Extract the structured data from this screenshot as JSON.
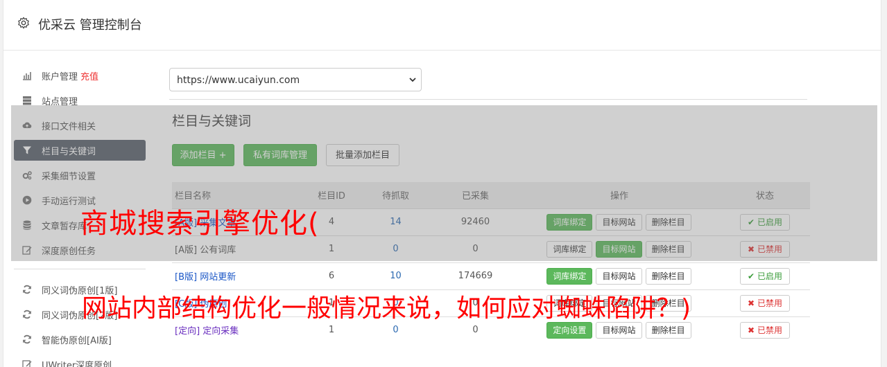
{
  "header": {
    "title": "优采云 管理控制台"
  },
  "sidebar": {
    "items": [
      {
        "label": "账户管理",
        "extra": "充值",
        "icon": "bar-chart-icon"
      },
      {
        "label": "站点管理",
        "icon": "server-icon"
      },
      {
        "label": "接口文件相关",
        "icon": "cloud-upload-icon"
      },
      {
        "label": "栏目与关键词",
        "icon": "filter-icon",
        "active": true
      },
      {
        "label": "采集细节设置",
        "icon": "gears-icon"
      },
      {
        "label": "手动运行测试",
        "icon": "play-circle-icon"
      },
      {
        "label": "文章暂存库",
        "icon": "database-icon"
      },
      {
        "label": "深度原创任务",
        "icon": "edit-icon"
      }
    ],
    "items2": [
      {
        "label": "同义词伪原创[1版]",
        "icon": "refresh-icon"
      },
      {
        "label": "同义词伪原创[2版]",
        "icon": "refresh-icon"
      },
      {
        "label": "智能伪原创[AI版]",
        "icon": "refresh-icon"
      },
      {
        "label": "UWriter深度原创",
        "icon": "edit-icon"
      }
    ]
  },
  "main": {
    "site_select": "https://www.ucaiyun.com",
    "section_title": "栏目与关键词",
    "buttons": {
      "add": "添加栏目 +",
      "private_lib": "私有词库管理",
      "batch_add": "批量添加栏目"
    },
    "table": {
      "headers": [
        "栏目名称",
        "栏目ID",
        "待抓取",
        "已采集",
        "操作",
        "状态"
      ],
      "rows": [
        {
          "tag": "[A版]",
          "name": "采集文章",
          "id": "4",
          "pending": "14",
          "collected": "92460",
          "ops": [
            "词库绑定",
            "目标网站",
            "删除栏目"
          ],
          "status": "已启用"
        },
        {
          "tag": "[A版]",
          "name": "公有词库",
          "id": "1",
          "pending": "0",
          "collected": "0",
          "ops": [
            "词库绑定",
            "目标网站",
            "删除栏目"
          ],
          "status": "已禁用"
        },
        {
          "tag": "[B版]",
          "name": "网站更新",
          "id": "6",
          "pending": "10",
          "collected": "174669",
          "ops": [
            "词库绑定",
            "目标网站",
            "删除栏目"
          ],
          "status": "已启用"
        },
        {
          "tag": "[C版]",
          "name": "伪原创",
          "id": "1",
          "pending": "0",
          "collected": "0",
          "ops": [
            "词库绑定",
            "目标网站",
            "删除栏目"
          ],
          "status": "已禁用"
        },
        {
          "tag": "[定向]",
          "name": "定向采集",
          "id": "1",
          "pending": "0",
          "collected": "0",
          "ops": [
            "定向设置",
            "目标网站",
            "删除栏目"
          ],
          "status": "已禁用"
        }
      ]
    }
  },
  "watermark": {
    "line1": "商城搜索引擎优化(",
    "line2": "网站内部结构优化一般情况来说，如何应对蜘蛛陷阱？)"
  }
}
